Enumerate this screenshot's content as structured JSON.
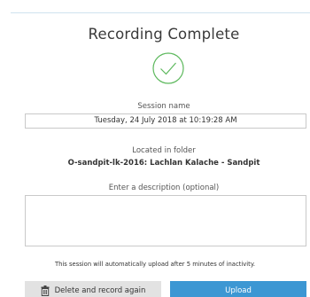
{
  "dialog": {
    "title": "Recording Complete",
    "status_icon": "checkmark-circle-icon",
    "session": {
      "label": "Session name",
      "value": "Tuesday, 24 July 2018 at 10:19:28 AM"
    },
    "folder": {
      "label": "Located in folder",
      "value": "O-sandpit-lk-2016: Lachlan Kalache - Sandpit"
    },
    "description": {
      "label": "Enter a description (optional)",
      "value": ""
    },
    "auto_upload_note": "This session will automatically upload after 5 minutes of inactivity.",
    "buttons": {
      "delete_label": "Delete and record again",
      "delete_icon": "trash-icon",
      "upload_label": "Upload"
    },
    "colors": {
      "accent": "#3c97d3",
      "check": "#5cb85c"
    }
  }
}
